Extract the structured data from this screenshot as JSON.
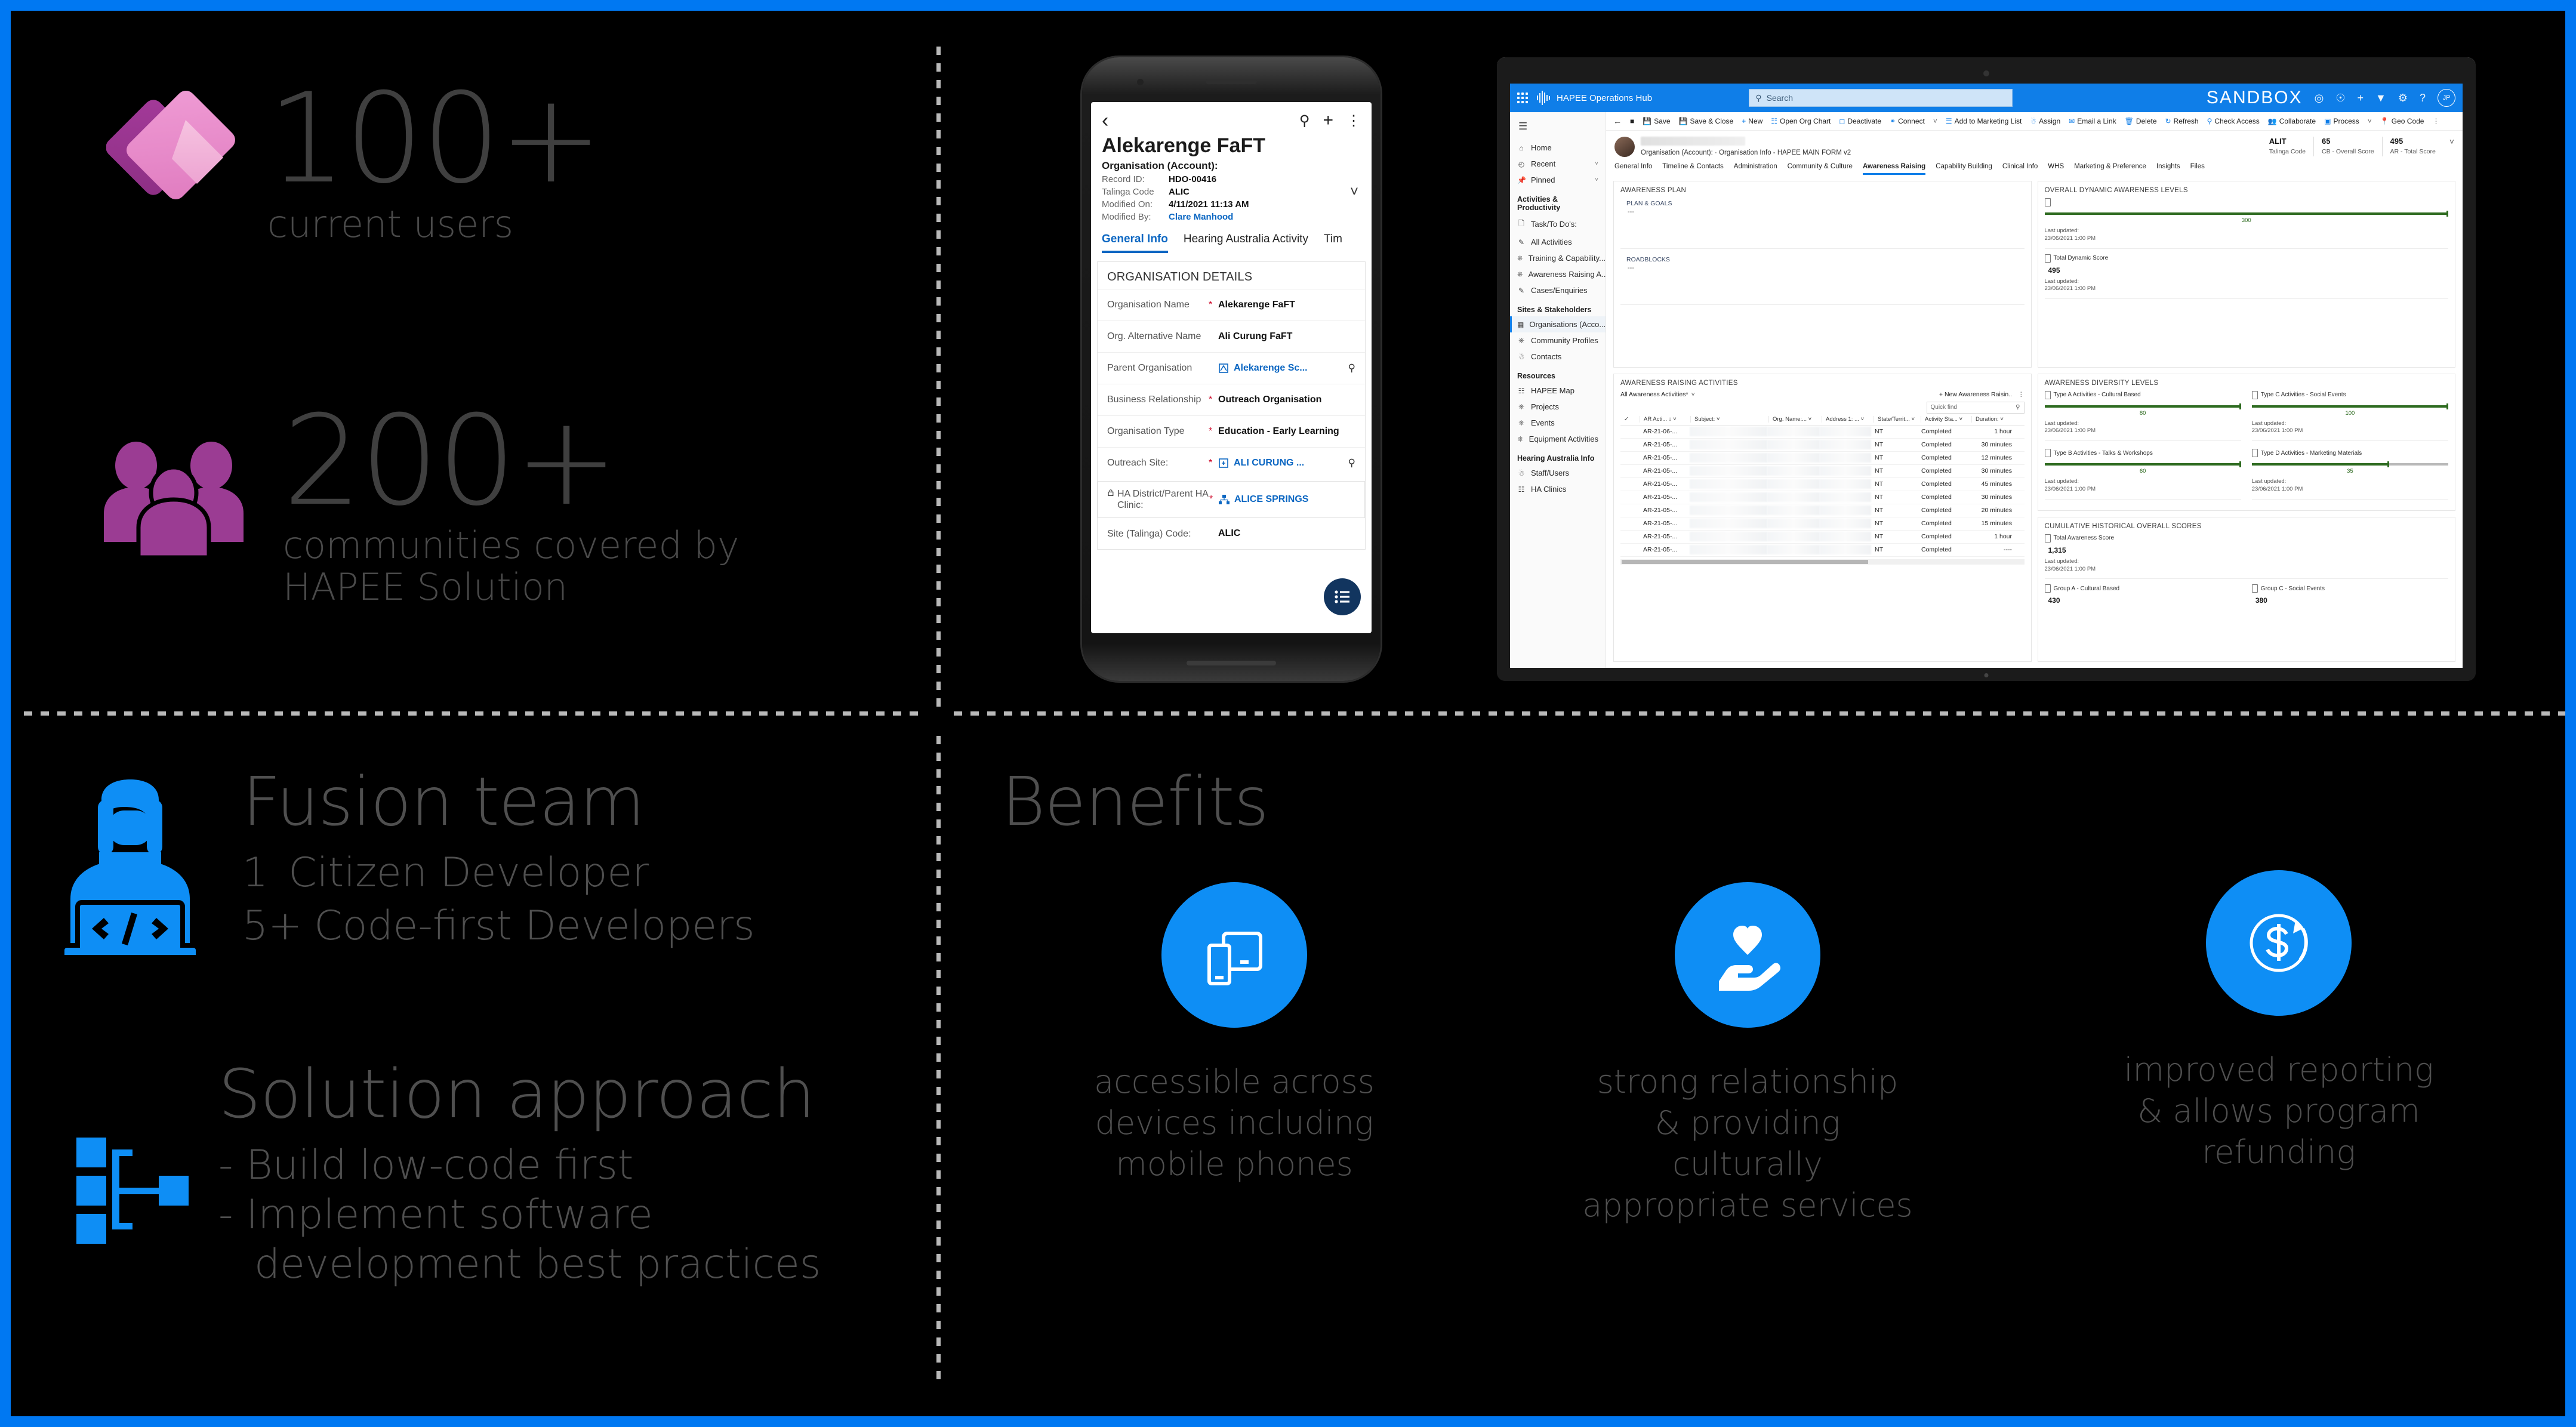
{
  "theme": {
    "accent_blue": "#0078f2",
    "icon_blue": "#0e8ef5",
    "powerapps_purple": "#9b3c93",
    "powerapps_pink": "#e58ac8",
    "text_grey": "#4f4f4f"
  },
  "stats": [
    {
      "icon": "powerapps-logo-icon",
      "number": "100+",
      "label": "current users"
    },
    {
      "icon": "people-group-icon",
      "number": "200+",
      "label": "communities covered by HAPEE Solution"
    }
  ],
  "fusion": {
    "icon": "developer-laptop-icon",
    "title": "Fusion team",
    "rows": [
      {
        "count": "1",
        "text": "Citizen Developer"
      },
      {
        "count": "5+",
        "text": "Code-first Developers"
      }
    ]
  },
  "solution": {
    "icon": "hierarchy-nodes-icon",
    "title": "Solution approach",
    "bullets": [
      "- Build low-code first",
      "- Implement software",
      "development best practices"
    ]
  },
  "benefits": {
    "title": "Benefits",
    "items": [
      {
        "icon": "devices-phone-tablet-icon",
        "caption": "accessible across devices including mobile phones"
      },
      {
        "icon": "heart-in-hand-icon",
        "caption": "strong relationship & providing culturally appropriate services"
      },
      {
        "icon": "dollar-refresh-icon",
        "caption": "improved reporting & allows program refunding"
      }
    ]
  },
  "phone": {
    "nav": {
      "back": "‹",
      "search": "search-icon",
      "add": "+",
      "more": "⋮"
    },
    "title": "Alekarenge FaFT",
    "subtitle": "Organisation (Account):",
    "meta": [
      {
        "key": "Record ID:",
        "value": "HDO-00416",
        "link": false
      },
      {
        "key": "Talinga Code",
        "value": "ALIC",
        "link": false
      },
      {
        "key": "Modified On:",
        "value": "4/11/2021 11:13 AM",
        "link": false
      },
      {
        "key": "Modified By:",
        "value": "Clare Manhood",
        "link": true
      }
    ],
    "tabs": [
      "General Info",
      "Hearing Australia Activity",
      "Tim"
    ],
    "active_tab": "General Info",
    "card_title": "ORGANISATION DETAILS",
    "fields": [
      {
        "label": "Organisation Name",
        "required": true,
        "value": "Alekarenge FaFT",
        "link": false,
        "lookup": false
      },
      {
        "label": "Org. Alternative Name",
        "required": false,
        "value": "Ali Curung FaFT",
        "link": false,
        "lookup": false
      },
      {
        "label": "Parent Organisation",
        "required": false,
        "value": "Alekarenge Sc...",
        "link": true,
        "lookup": true
      },
      {
        "label": "Business Relationship",
        "required": true,
        "value": "Outreach Organisation",
        "link": false,
        "lookup": false
      },
      {
        "label": "Organisation Type",
        "required": true,
        "value": "Education - Early Learning",
        "link": false,
        "lookup": false
      },
      {
        "label": "Outreach Site:",
        "required": true,
        "value": "ALI CURUNG ...",
        "link": true,
        "lookup": true
      },
      {
        "label": "HA District/Parent HA Clinic:",
        "required": true,
        "value": "ALICE SPRINGS",
        "link": true,
        "lookup": false,
        "locked": true
      },
      {
        "label": "Site (Talinga) Code:",
        "required": false,
        "value": "ALIC",
        "link": false,
        "lookup": false
      }
    ]
  },
  "tablet": {
    "topbar": {
      "app_name": "HAPEE Operations Hub",
      "search_placeholder": "Search",
      "env_label": "SANDBOX",
      "avatar_initials": "JP",
      "icons": [
        "waffle-icon",
        "search-icon",
        "target-icon",
        "lightbulb-icon",
        "plus-icon",
        "filter-icon",
        "gear-icon",
        "help-icon"
      ]
    },
    "commands": [
      "Save",
      "Save & Close",
      "New",
      "Open Org Chart",
      "Deactivate",
      "Connect",
      "Add to Marketing List",
      "Assign",
      "Email a Link",
      "Delete",
      "Refresh",
      "Check Access",
      "Collaborate",
      "Process",
      "Geo Code"
    ],
    "nav": {
      "home": "Home",
      "recent": "Recent",
      "pinned": "Pinned",
      "groups": [
        {
          "title": "Activities & Productivity",
          "items": [
            "Task/To Do's:",
            "All Activities",
            "Training & Capability...",
            "Awareness Raising A...",
            "Cases/Enquiries"
          ]
        },
        {
          "title": "Sites & Stakeholders",
          "items": [
            "Organisations (Acco...",
            "Community Profiles",
            "Contacts"
          ]
        },
        {
          "title": "Resources",
          "items": [
            "HAPEE Map",
            "Projects",
            "Events",
            "Equipment Activities"
          ]
        },
        {
          "title": "Hearing Australia Info",
          "items": [
            "Staff/Users",
            "HA Clinics"
          ]
        }
      ],
      "selected": "Organisations (Acco..."
    },
    "record": {
      "breadcrumb": "Organisation (Account):  ·  Organisation Info - HAPEE MAIN FORM v2",
      "scores": [
        {
          "value": "ALIT",
          "label": "Talinga Code"
        },
        {
          "value": "65",
          "label": "CB - Overall Score"
        },
        {
          "value": "495",
          "label": "AR - Total Score"
        }
      ]
    },
    "form_tabs": [
      "General Info",
      "Timeline & Contacts",
      "Administration",
      "Community & Culture",
      "Awareness Raising",
      "Capability Building",
      "Clinical Info",
      "WHS",
      "Marketing & Preference",
      "Insights",
      "Files"
    ],
    "form_tab_active": "Awareness Raising",
    "awareness_plan": {
      "title": "AWARENESS PLAN",
      "sections": [
        {
          "label": "PLAN & GOALS",
          "value": "---"
        },
        {
          "label": "ROADBLOCKS",
          "value": "---"
        }
      ]
    },
    "overall_dynamic": {
      "title": "OVERALL DYNAMIC AWARENESS LEVELS",
      "bar": {
        "value": "300",
        "percent": 100
      },
      "last_updated_label": "Last updated:",
      "last_updated": "23/06/2021 1:00 PM",
      "total": {
        "label": "Total Dynamic Score",
        "value": "495",
        "last_updated_label": "Last updated:",
        "last_updated": "23/06/2021 1:00 PM"
      }
    },
    "awareness_raising": {
      "title": "AWARENESS RAISING ACTIVITIES",
      "view": "All Awareness Activities*",
      "new_button": "New Awareness Raisin..",
      "quickfind_placeholder": "Quick find",
      "columns": [
        "AR Acti...",
        "Subject:",
        "Org. Name:...",
        "Address 1: ...",
        "State/Territ...",
        "Activity Sta...",
        "Duration:"
      ],
      "rows": [
        {
          "id": "AR-21-06-...",
          "state": "NT",
          "status": "Completed",
          "duration": "1 hour"
        },
        {
          "id": "AR-21-05-...",
          "state": "NT",
          "status": "Completed",
          "duration": "30 minutes"
        },
        {
          "id": "AR-21-05-...",
          "state": "NT",
          "status": "Completed",
          "duration": "12 minutes"
        },
        {
          "id": "AR-21-05-...",
          "state": "NT",
          "status": "Completed",
          "duration": "30 minutes"
        },
        {
          "id": "AR-21-05-...",
          "state": "NT",
          "status": "Completed",
          "duration": "45 minutes"
        },
        {
          "id": "AR-21-05-...",
          "state": "NT",
          "status": "Completed",
          "duration": "30 minutes"
        },
        {
          "id": "AR-21-05-...",
          "state": "NT",
          "status": "Completed",
          "duration": "20 minutes"
        },
        {
          "id": "AR-21-05-...",
          "state": "NT",
          "status": "Completed",
          "duration": "15 minutes"
        },
        {
          "id": "AR-21-05-...",
          "state": "NT",
          "status": "Completed",
          "duration": "1 hour"
        },
        {
          "id": "AR-21-05-...",
          "state": "NT",
          "status": "Completed",
          "duration": "----"
        }
      ]
    },
    "diversity": {
      "title": "AWARENESS DIVERSITY LEVELS",
      "items": [
        {
          "label": "Type A Activities - Cultural Based",
          "value": "80",
          "percent": 100,
          "last_updated_label": "Last updated:",
          "last_updated": "23/06/2021 1:00 PM"
        },
        {
          "label": "Type C Activities - Social Events",
          "value": "100",
          "percent": 100,
          "last_updated_label": "Last updated:",
          "last_updated": "23/06/2021 1:00 PM"
        },
        {
          "label": "Type B Activities - Talks & Workshops",
          "value": "60",
          "percent": 100,
          "last_updated_label": "Last updated:",
          "last_updated": "23/06/2021 1:00 PM"
        },
        {
          "label": "Type D Activities - Marketing Materials",
          "value": "35",
          "percent": 70,
          "last_updated_label": "Last updated:",
          "last_updated": "23/06/2021 1:00 PM"
        }
      ]
    },
    "cumulative": {
      "title": "CUMULATIVE HISTORICAL OVERALL SCORES",
      "total": {
        "label": "Total Awareness Score",
        "value": "1,315",
        "last_updated_label": "Last updated:",
        "last_updated": "23/06/2021 1:00 PM"
      },
      "groups": [
        {
          "label": "Group A - Cultural Based",
          "value": "430"
        },
        {
          "label": "Group C - Social Events",
          "value": "380"
        }
      ]
    }
  }
}
